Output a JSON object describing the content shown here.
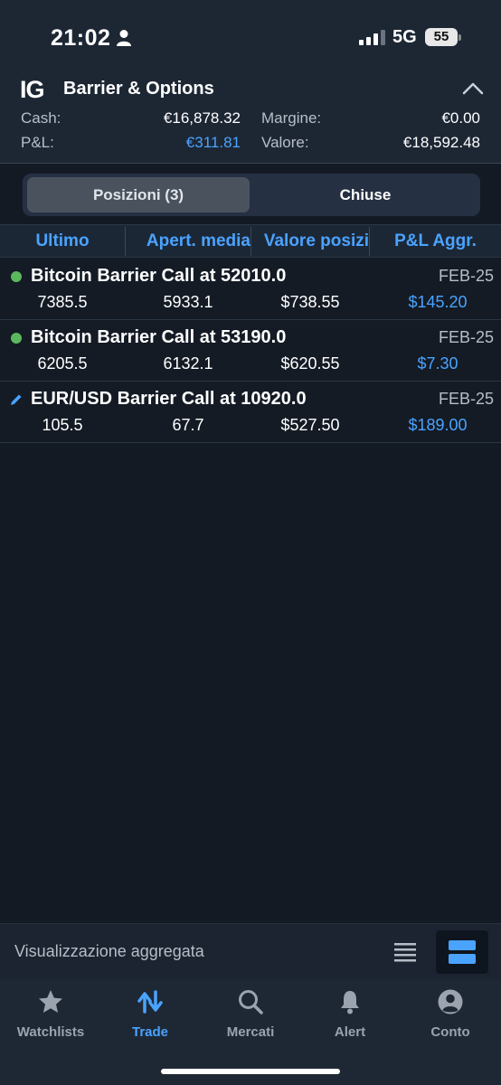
{
  "status_bar": {
    "time": "21:02",
    "network": "5G",
    "battery": "55"
  },
  "header": {
    "logo": "IG",
    "title": "Barrier & Options",
    "summary": {
      "cash_label": "Cash:",
      "cash_value": "€16,878.32",
      "margin_label": "Margine:",
      "margin_value": "€0.00",
      "pl_label": "P&L:",
      "pl_value": "€311.81",
      "value_label": "Valore:",
      "value_value": "€18,592.48"
    }
  },
  "segments": {
    "open": "Posizioni (3)",
    "closed": "Chiuse"
  },
  "columns": [
    "Ultimo",
    "Apert. media",
    "Valore posizi",
    "P&L Aggr."
  ],
  "positions": [
    {
      "name": "Bitcoin Barrier Call at 52010.0",
      "expiry": "FEB-25",
      "last": "7385.5",
      "avg_open": "5933.1",
      "value": "$738.55",
      "pl": "$145.20",
      "marker": "green-dot"
    },
    {
      "name": "Bitcoin Barrier Call at 53190.0",
      "expiry": "FEB-25",
      "last": "6205.5",
      "avg_open": "6132.1",
      "value": "$620.55",
      "pl": "$7.30",
      "marker": "green-dot"
    },
    {
      "name": "EUR/USD Barrier Call at 10920.0",
      "expiry": "FEB-25",
      "last": "105.5",
      "avg_open": "67.7",
      "value": "$527.50",
      "pl": "$189.00",
      "marker": "pencil-icon"
    }
  ],
  "bottom_bar": {
    "label": "Visualizzazione aggregata"
  },
  "tabs": [
    {
      "label": "Watchlists",
      "icon": "star-icon"
    },
    {
      "label": "Trade",
      "icon": "trade-arrows-icon"
    },
    {
      "label": "Mercati",
      "icon": "search-icon"
    },
    {
      "label": "Alert",
      "icon": "bell-icon"
    },
    {
      "label": "Conto",
      "icon": "account-icon"
    }
  ],
  "active_tab": "Trade",
  "colors": {
    "accent": "#4aa3ff",
    "background": "#131a24",
    "header": "#1d2734",
    "status_dot": "#5cb85c"
  }
}
